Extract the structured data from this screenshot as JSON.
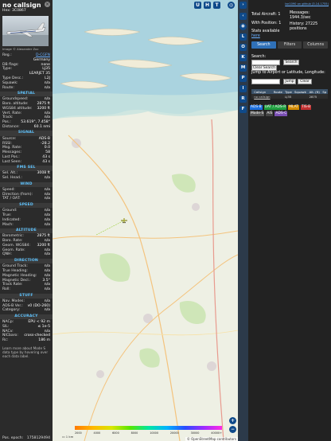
{
  "aircraft": {
    "callsign": "no callsign",
    "hex_label": "Hex:",
    "hex": "3C0867",
    "photo_credit": "Image © Alexander Zoc",
    "reg_label": "Reg.:",
    "reg": "D-CGFN",
    "country": "Germany",
    "db_flags_label": "DB flags:",
    "db_flags": "none",
    "type_label": "Type:",
    "type": "LJ35",
    "type_full": "LEARJET 35",
    "type_desc_label": "Type Desc.:",
    "type_desc": "L2J",
    "squawk_label": "Squawk:",
    "squawk": "n/a",
    "route_label": "Route:",
    "route": "n/a"
  },
  "sections": {
    "spatial": "SPATIAL",
    "signal": "SIGNAL",
    "fms_sel": "FMS SEL",
    "wind": "WIND",
    "speed": "SPEED",
    "altitude": "ALTITUDE",
    "direction": "DIRECTION",
    "stuff": "STUFF",
    "accuracy": "ACCURACY"
  },
  "spatial": [
    {
      "k": "Groundspeed:",
      "v": "n/a"
    },
    {
      "k": "Baro. altitude:",
      "v": "2875 ft"
    },
    {
      "k": "WGS84 altitude:",
      "v": "3200 ft"
    },
    {
      "k": "Vert. Rate:",
      "v": "n/a"
    },
    {
      "k": "Track:",
      "v": "n/a"
    },
    {
      "k": "Pos.:",
      "v": "53.619°, 7.458°"
    },
    {
      "k": "Distance:",
      "v": "60.1 nmi"
    }
  ],
  "signal": [
    {
      "k": "Source:",
      "v": "ADS-B"
    },
    {
      "k": "RSSI:",
      "v": "-28.2"
    },
    {
      "k": "Msg. Rate:",
      "v": "0.0"
    },
    {
      "k": "Messages:",
      "v": "58"
    },
    {
      "k": "Last Pos.:",
      "v": "43 s"
    },
    {
      "k": "Last Seen:",
      "v": "43 s"
    }
  ],
  "fms": [
    {
      "k": "Sel. Alt.:",
      "v": "3008 ft"
    },
    {
      "k": "Sel. Head.:",
      "v": "n/a"
    }
  ],
  "wind": [
    {
      "k": "Speed:",
      "v": "n/a"
    },
    {
      "k": "Direction (from):",
      "v": "n/a"
    },
    {
      "k": "TAT / OAT:",
      "v": "n/a"
    }
  ],
  "speed": [
    {
      "k": "Ground:",
      "v": "n/a"
    },
    {
      "k": "True:",
      "v": "n/a"
    },
    {
      "k": "Indicated:",
      "v": "n/a"
    },
    {
      "k": "Mach:",
      "v": "n/a"
    }
  ],
  "altitude": [
    {
      "k": "Barometric:",
      "v": "2875 ft"
    },
    {
      "k": "Baro. Rate:",
      "v": "n/a"
    },
    {
      "k": "Geom. WGS84:",
      "v": "3200 ft"
    },
    {
      "k": "Geom. Rate:",
      "v": "n/a"
    },
    {
      "k": "QNH:",
      "v": "n/a"
    }
  ],
  "direction": [
    {
      "k": "Ground Track:",
      "v": "n/a"
    },
    {
      "k": "True Heading:",
      "v": "n/a"
    },
    {
      "k": "Magnetic Heading:",
      "v": "n/a"
    },
    {
      "k": "Magnetic Decl.:",
      "v": "3.5°"
    },
    {
      "k": "Track Rate:",
      "v": "n/a"
    },
    {
      "k": "Roll:",
      "v": "n/a"
    }
  ],
  "stuff": [
    {
      "k": "Nav. Modes:",
      "v": "n/a"
    },
    {
      "k": "ADS-B Ver.:",
      "v": "v0 (DO-260)"
    },
    {
      "k": "Category:",
      "v": "n/a"
    }
  ],
  "accuracy": [
    {
      "k": "NACp:",
      "v": "EPU < 92 m"
    },
    {
      "k": "SIL:",
      "v": "≤ 1e-5"
    },
    {
      "k": "NACv:",
      "v": "n/a"
    },
    {
      "k": "NICbaro:",
      "v": "cross-checked"
    },
    {
      "k": "Rc:",
      "v": "186 m"
    }
  ],
  "learn_more": "Learn more about Mode S data type by hovering over each data label.",
  "epoch_label": "Pos. epoch:",
  "epoch": "1758129494",
  "map_controls": {
    "u": "U",
    "h": "H",
    "t": "T",
    "zoom_in": "+",
    "zoom_out": "−",
    "scale": "1 km",
    "attribution": "© OpenStreetMap contributors"
  },
  "alt_scale": [
    "2000",
    "4000",
    "6000",
    "8000",
    "10000",
    "20000",
    "30000",
    "40000+"
  ],
  "toolbar": [
    "L",
    "O",
    "K",
    "M",
    "P",
    "I",
    "R",
    "F"
  ],
  "right": {
    "github": "tar1090 on github (3.14.1755)",
    "total_aircraft": "Total Aircraft: 1",
    "with_position": "With Position: 1",
    "stats_available": "Stats available",
    "stats_link": "here",
    "messages": "Messages: 1944.3/sec",
    "history": "History: 27225 positions",
    "tabs": [
      "Search",
      "Filters",
      "Columns"
    ],
    "search_label": "Search:",
    "search_button": "Search",
    "clear_search": "Clear Search",
    "jump_label": "Jump to Airport or Latitude, Longitude:",
    "jump_button": "Jump",
    "clear_button": "Clear",
    "table_headers": [
      "",
      "Callsign",
      "Route",
      "Type",
      "Squawk",
      "Alt. (ft)",
      "Sp"
    ],
    "table_rows": [
      [
        "",
        "no callsign",
        "",
        "LJ35",
        "",
        "2875",
        ""
      ]
    ],
    "sources": [
      "ADS-B",
      "UAT / ADS-R",
      "MLAT",
      "TIS-B",
      "Mode-S",
      "AIS",
      "ADS-C"
    ]
  },
  "colors": {
    "accent": "#2f70b7",
    "section": "#5fc4ff",
    "ads_b": "#1d6fdc",
    "uat": "#20a040",
    "mlat": "#d28a00",
    "tisb": "#c03030",
    "modes": "#555555",
    "ais": "#444444",
    "adsc": "#7a4fb3"
  }
}
